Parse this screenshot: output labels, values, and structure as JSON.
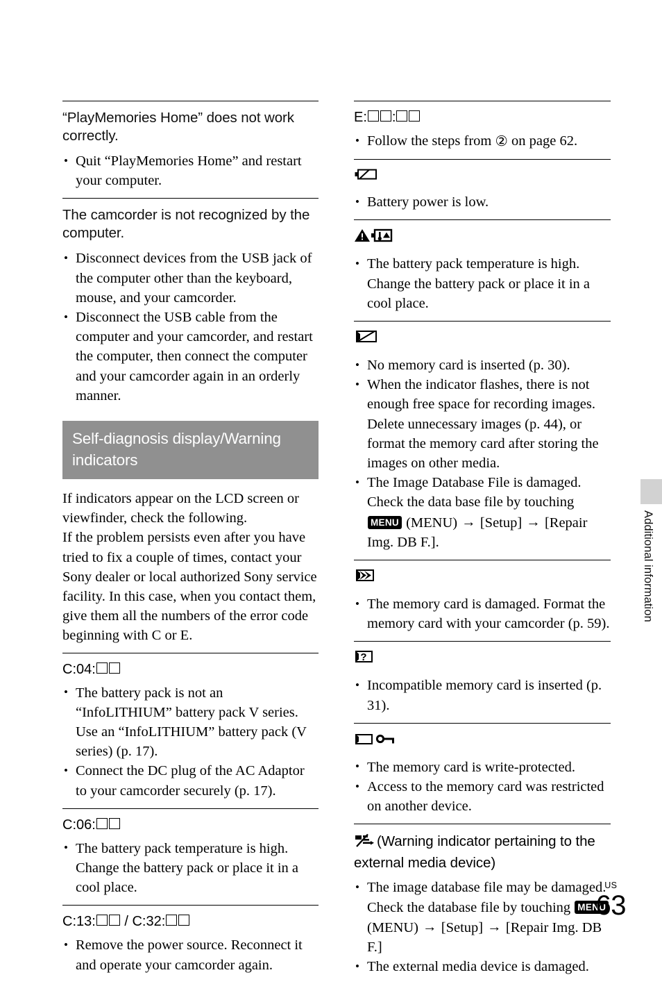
{
  "page": {
    "folio_locale": "US",
    "folio_number": "63",
    "side_label": "Additional information",
    "banner_color": "#909090",
    "tab_color": "#d2d2d2"
  },
  "left_column": {
    "sections": [
      {
        "id": "playmemories-not-working",
        "kind": "question",
        "heading": "“PlayMemories Home” does not work correctly.",
        "bullets": [
          "Quit “PlayMemories Home” and restart your computer."
        ]
      },
      {
        "id": "camcorder-not-recognized",
        "kind": "question",
        "heading": "The camcorder is not recognized by the computer.",
        "bullets": [
          "Disconnect devices from the USB jack of the computer other than the keyboard, mouse, and your camcorder.",
          "Disconnect the USB cable from the computer and your camcorder, and restart the computer, then connect the computer and your camcorder again in an orderly manner."
        ]
      }
    ],
    "banner": {
      "title": "Self-diagnosis display/Warning indicators"
    },
    "intro": {
      "paragraph_1": "If indicators appear on the LCD screen or viewfinder, check the following.",
      "paragraph_2": "If the problem persists even after you have tried to fix a couple of times, contact your Sony dealer or local authorized Sony service facility. In this case, when you contact them, give them all the numbers of the error code beginning with C or E."
    },
    "codes": [
      {
        "id": "c04",
        "code_prefix": "C:04:",
        "placeholder_count": 2,
        "bullets": [
          "The battery pack is not an “InfoLITHIUM” battery pack V series. Use an “InfoLITHIUM” battery pack (V series) (p. 17).",
          "Connect the DC plug of the AC Adaptor to your camcorder securely (p. 17)."
        ]
      },
      {
        "id": "c06",
        "code_prefix": "C:06:",
        "placeholder_count": 2,
        "bullets": [
          "The battery pack temperature is high. Change the battery pack or place it in a cool place."
        ]
      },
      {
        "id": "c13-c32",
        "code_prefix": "C:13:",
        "code_separator": " / ",
        "code_prefix_2": "C:32:",
        "placeholder_count": 2,
        "bullets": [
          "Remove the power source. Reconnect it and operate your camcorder again."
        ]
      }
    ]
  },
  "right_column": {
    "sections": [
      {
        "id": "e-code",
        "kind": "code",
        "code_prefix": "E:",
        "code_middle": ":",
        "placeholder_count_a": 2,
        "placeholder_count_b": 2,
        "bullets_rich": [
          {
            "parts": [
              {
                "type": "text",
                "value": "Follow the steps from "
              },
              {
                "type": "circled",
                "value": "②"
              },
              {
                "type": "text",
                "value": " on page 62."
              }
            ]
          }
        ]
      },
      {
        "id": "battery-low",
        "kind": "icon",
        "icon": "battery-low-icon",
        "bullets": [
          "Battery power is low."
        ]
      },
      {
        "id": "battery-temperature-high",
        "kind": "icon",
        "icon": "warning-battery-temperature-icon",
        "bullets": [
          "The battery pack temperature is high. Change the battery pack or place it in a cool place."
        ]
      },
      {
        "id": "no-memory-card",
        "kind": "icon",
        "icon": "no-memory-card-icon",
        "bullets": [
          "No memory card is inserted (p. 30).",
          "When the indicator flashes, there is not enough free space for recording images. Delete unnecessary images (p. 44), or format the memory card after storing the images on other media."
        ],
        "bullets_rich": [
          {
            "parts": [
              {
                "type": "text",
                "value": "The Image Database File is damaged. Check the data base file by touching "
              },
              {
                "type": "menu-badge",
                "value": "MENU"
              },
              {
                "type": "text",
                "value": " (MENU) "
              },
              {
                "type": "arrow",
                "value": "→"
              },
              {
                "type": "text",
                "value": " [Setup] "
              },
              {
                "type": "arrow",
                "value": "→"
              },
              {
                "type": "text",
                "value": " [Repair Img. DB F.]."
              }
            ]
          }
        ]
      },
      {
        "id": "memory-card-damaged",
        "kind": "icon",
        "icon": "memory-card-damaged-icon",
        "bullets": [
          "The memory card is damaged. Format the memory card with your camcorder (p. 59)."
        ]
      },
      {
        "id": "memory-card-incompatible",
        "kind": "icon",
        "icon": "memory-card-incompatible-icon",
        "bullets": [
          "Incompatible memory card is inserted (p. 31)."
        ]
      },
      {
        "id": "memory-card-write-protected",
        "kind": "icon",
        "icon": "memory-card-write-protect-icon",
        "bullets": [
          "The memory card is write-protected.",
          "Access to the memory card was restricted on another device."
        ]
      },
      {
        "id": "external-media-warning",
        "kind": "icon-heading",
        "icon": "external-media-warning-icon",
        "heading_text": "(Warning indicator pertaining to the external media device)",
        "bullets": [
          "The external media device is damaged."
        ],
        "bullets_rich": [
          {
            "parts": [
              {
                "type": "text",
                "value": "The image database file may be damaged. Check the database file by touching "
              },
              {
                "type": "menu-badge",
                "value": "MENU"
              },
              {
                "type": "text",
                "value": " (MENU) "
              },
              {
                "type": "arrow",
                "value": "→"
              },
              {
                "type": "text",
                "value": " [Setup] "
              },
              {
                "type": "arrow",
                "value": "→"
              },
              {
                "type": "text",
                "value": " [Repair Img. DB F.]"
              }
            ]
          }
        ]
      }
    ]
  }
}
